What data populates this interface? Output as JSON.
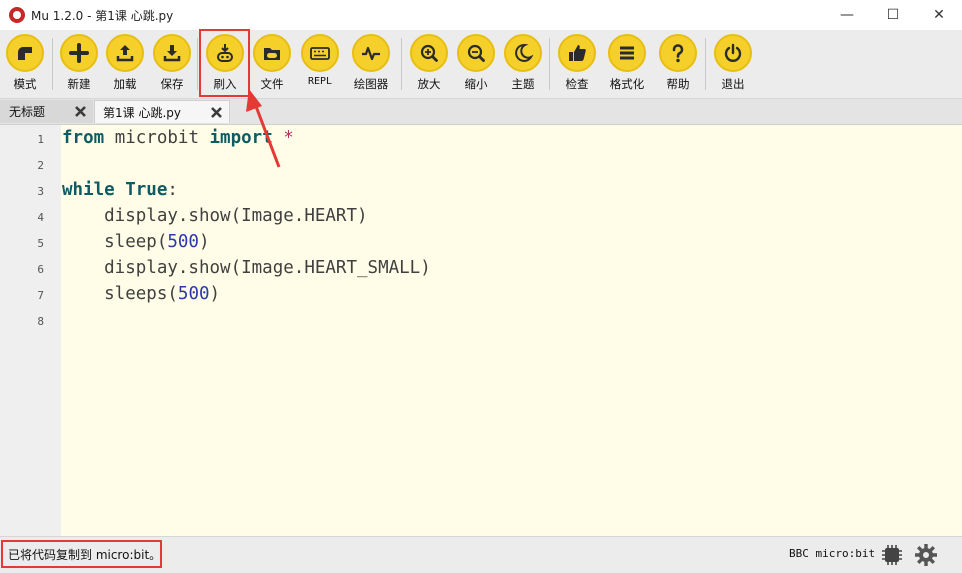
{
  "window": {
    "title": "Mu 1.2.0 - 第1课 心跳.py",
    "minimize_label": "—",
    "maximize_label": "☐",
    "close_label": "✕"
  },
  "toolbar": {
    "accent_color": "#f5d02a",
    "buttons": [
      {
        "label": "模式",
        "icon": "mode-icon"
      },
      {
        "label": "新建",
        "icon": "plus-icon"
      },
      {
        "label": "加载",
        "icon": "upload-icon"
      },
      {
        "label": "保存",
        "icon": "download-icon"
      },
      {
        "label": "刷入",
        "icon": "flash-icon"
      },
      {
        "label": "文件",
        "icon": "folder-icon"
      },
      {
        "label": "REPL",
        "icon": "keyboard-icon"
      },
      {
        "label": "绘图器",
        "icon": "pulse-icon"
      },
      {
        "label": "放大",
        "icon": "zoom-in-icon"
      },
      {
        "label": "缩小",
        "icon": "zoom-out-icon"
      },
      {
        "label": "主题",
        "icon": "moon-icon"
      },
      {
        "label": "检查",
        "icon": "thumbs-up-icon"
      },
      {
        "label": "格式化",
        "icon": "lines-icon"
      },
      {
        "label": "帮助",
        "icon": "question-icon"
      },
      {
        "label": "退出",
        "icon": "power-icon"
      }
    ]
  },
  "tabs": [
    {
      "label": "无标题",
      "active": false
    },
    {
      "label": "第1课 心跳.py",
      "active": true
    }
  ],
  "editor": {
    "line_numbers": [
      "1",
      "2",
      "3",
      "4",
      "5",
      "6",
      "7",
      "8"
    ],
    "lines": [
      "from microbit import *",
      "",
      "while True:",
      "    display.show(Image.HEART)",
      "    sleep(500)",
      "    display.show(Image.HEART_SMALL)",
      "    sleeps(500)",
      ""
    ]
  },
  "status": {
    "message": "已将代码复制到 micro:bit。",
    "mode": "BBC micro:bit"
  },
  "colors": {
    "editor_background": "#fffde7",
    "highlight": "#e53935"
  }
}
